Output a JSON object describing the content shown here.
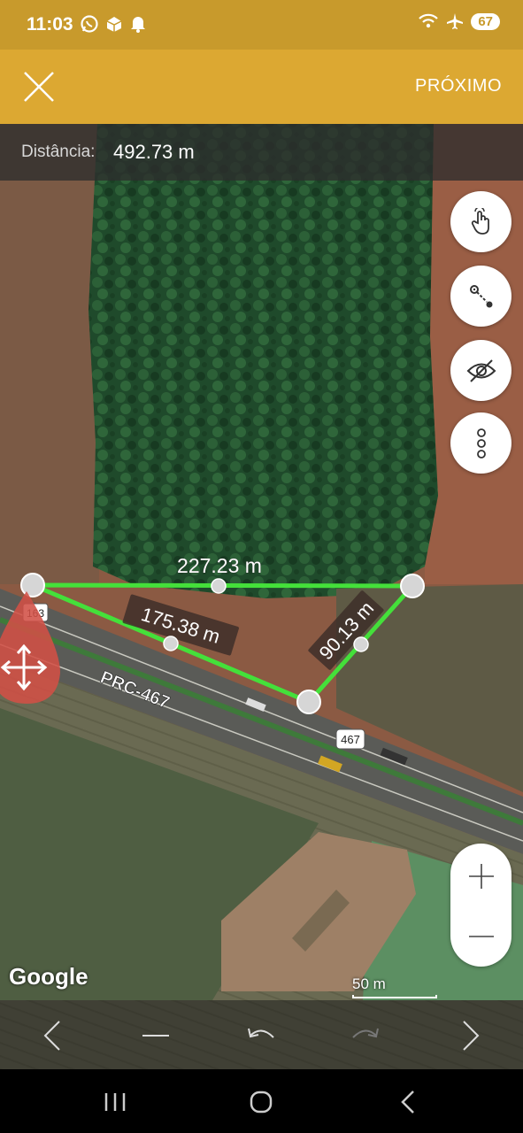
{
  "status_bar": {
    "time": "11:03",
    "battery": "67"
  },
  "header": {
    "next_label": "PRÓXIMO"
  },
  "measurement": {
    "distance_label": "Distância:",
    "distance_value": "492.73 m"
  },
  "map": {
    "segments": [
      {
        "label": "227.23 m"
      },
      {
        "label": "175.38 m"
      },
      {
        "label": "90.13 m"
      }
    ],
    "road_label": "PRC-467",
    "shield_163": "163",
    "shield_467": "467",
    "google_logo": "Google",
    "scale_label": "50 m"
  },
  "colors": {
    "accent": "#dca832",
    "status": "#c89a2c",
    "measure_line": "#44e03a"
  },
  "icons": {
    "close": "close-icon",
    "touch": "hand-pointer-icon",
    "point": "move-point-icon",
    "visibility": "eye-off-icon",
    "more": "more-vertical-icon",
    "zoom_in": "plus-icon",
    "zoom_out": "minus-icon",
    "prev": "chevron-left-icon",
    "next": "chevron-right-icon",
    "remove": "minus-icon",
    "undo": "undo-icon",
    "redo": "redo-icon"
  }
}
